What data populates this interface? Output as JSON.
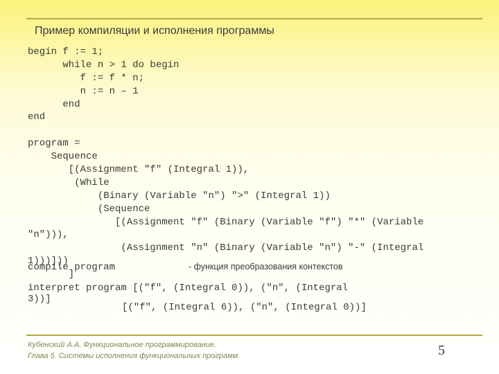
{
  "title": "Пример компиляции и исполнения программы",
  "code_block": "begin f := 1;\n      while n > 1 do begin\n         f := f * n;\n         n := n – 1\n      end\nend\n\nprogram =\n    Sequence\n       [(Assignment \"f\" (Integral 1)),\n        (While\n            (Binary (Variable \"n\") \">\" (Integral 1))\n            (Sequence\n               [(Assignment \"f\" (Binary (Variable \"f\") \"*\" (Variable\n\"n\"))),\n                (Assignment \"n\" (Binary (Variable \"n\") \"-\" (Integral\n1)))]))\n       ]",
  "compile_text": "compile program",
  "compile_note": "- функция преобразования контекстов",
  "interpret_text": "interpret program [(\"f\", (Integral 0)), (\"n\", (Integral\n3))]",
  "result_text": "[(\"f\", (Integral 6)), (\"n\", (Integral 0))]",
  "footer_line1": "Кубенский А.А. Функциональное программирование.",
  "footer_line2": "Глава 5. Системы исполнения функциональных программ.",
  "page_number": "5"
}
